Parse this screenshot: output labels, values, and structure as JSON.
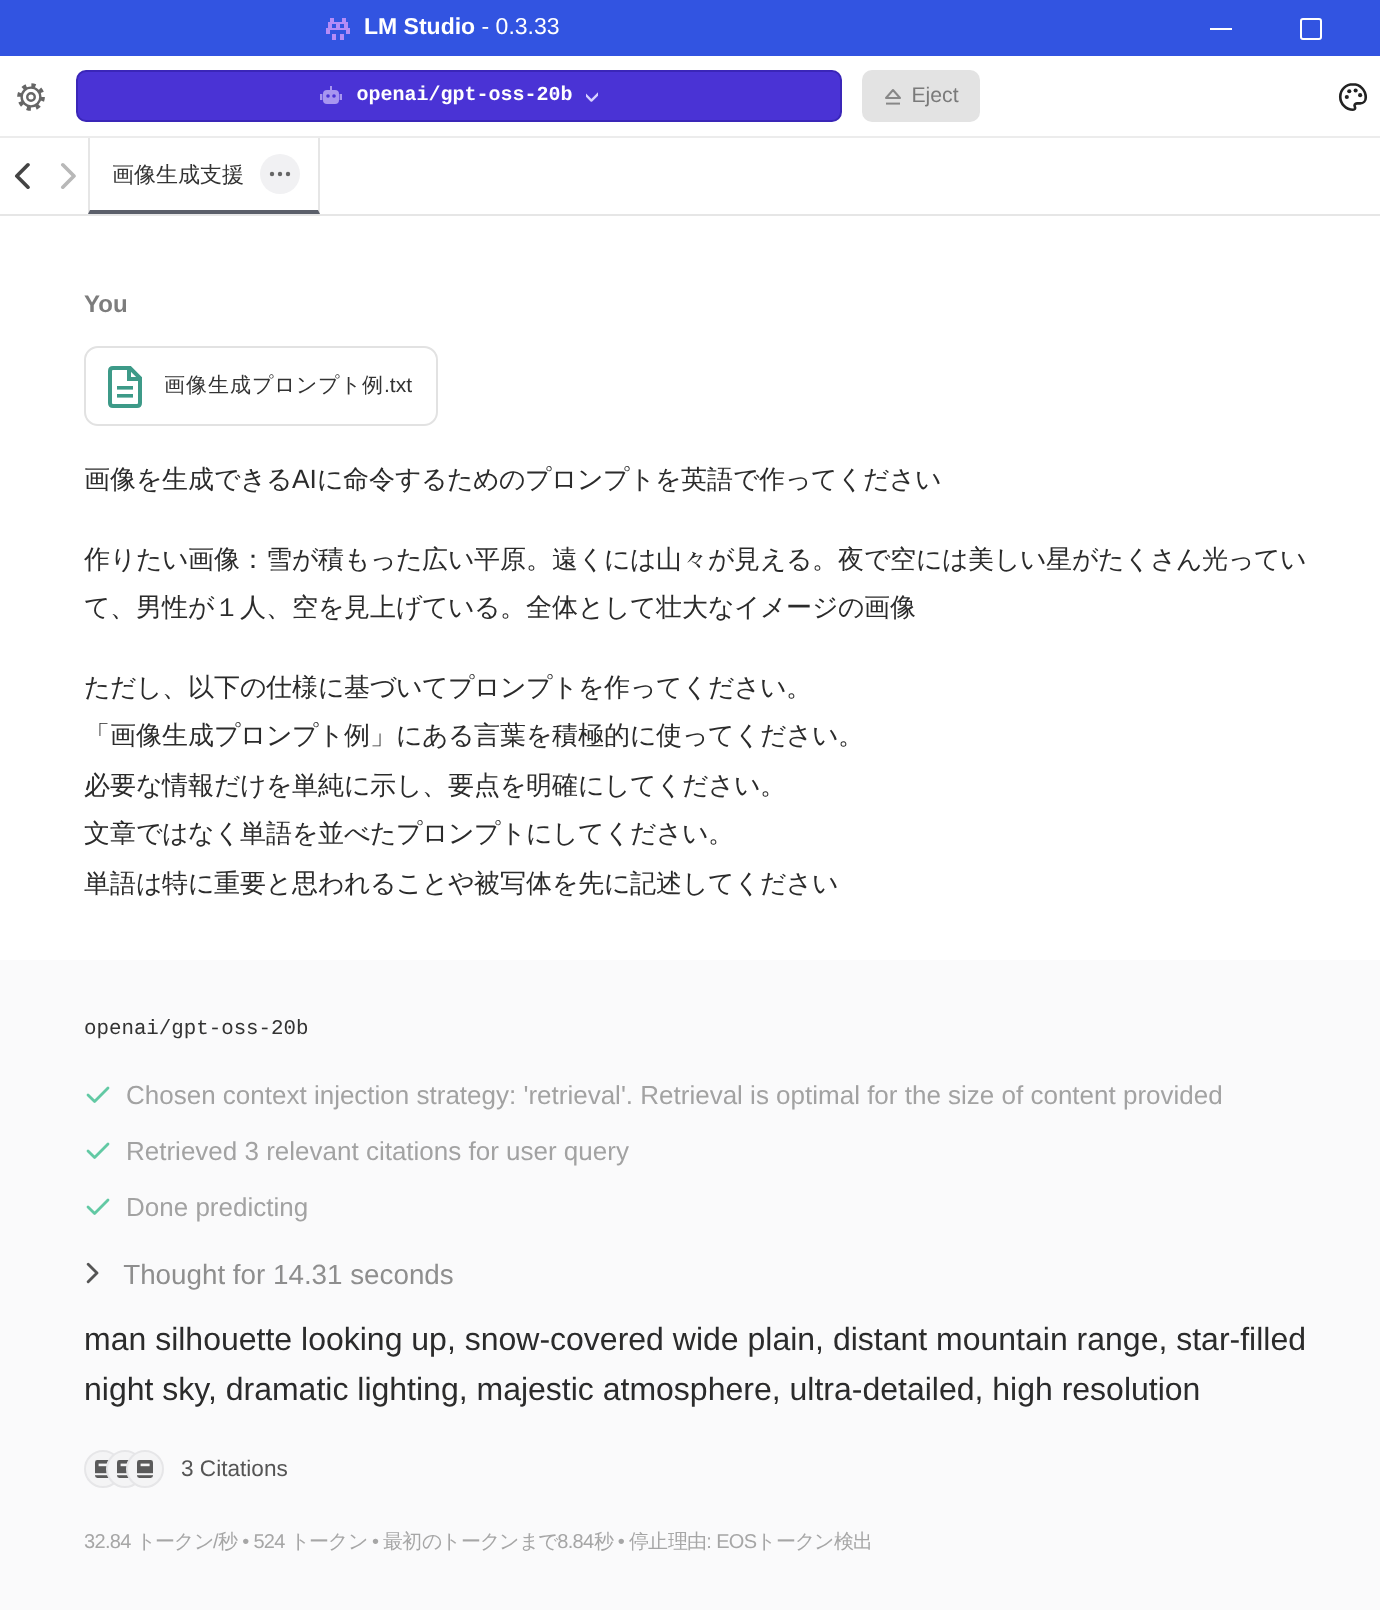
{
  "title_bar": {
    "title": "**LM Studio** - 0.3.33"
  },
  "toolbar": {
    "model": "openai/gpt-oss-20b",
    "eject": "Eject"
  },
  "tab_bar": {
    "nav": [
      {
        "kind": "back",
        "disabled": false
      },
      {
        "kind": "forward",
        "disabled": true
      }
    ],
    "tabs": [
      {
        "label": "画像生成支援",
        "selected": true
      }
    ]
  },
  "user_message": {
    "sender": "You",
    "attachments": [
      {
        "name": "画像生成プロンプト例.txt"
      }
    ],
    "paragraphs": [
      {
        "lines": [
          "画像を生成できるAIに命令するためのプロンプトを英語で作ってください"
        ]
      },
      {
        "lines": [
          "作りたい画像：雪が積もった広い平原。遠くには山々が見える。夜で空には美しい星がたくさん光っていて、男性が１人、空を見上げている。全体として壮大なイメージの画像"
        ]
      },
      {
        "lines": [
          "ただし、以下の仕様に基づいてプロンプトを作ってください。",
          "「画像生成プロンプト例」にある言葉を積極的に使ってください。",
          "必要な情報だけを単純に示し、要点を明確にしてください。",
          "文章ではなく単語を並べたプロンプトにしてください。",
          "単語は特に重要と思われることや被写体を先に記述してください"
        ]
      }
    ]
  },
  "assistant_message": {
    "model": "openai/gpt-oss-20b",
    "steps": [
      {
        "text": "Chosen context injection strategy: 'retrieval'. Retrieval is optimal for the size of content provided",
        "done": true
      },
      {
        "text": "Retrieved 3 relevant citations for user query",
        "done": true
      },
      {
        "text": "Done predicting",
        "done": true
      }
    ],
    "thought": {
      "label": "Thought for 14.31 seconds",
      "expanded": false
    },
    "response": "man silhouette looking up, snow-covered wide plain, distant mountain range, star-filled night sky, dramatic lighting, majestic atmosphere, ultra-detailed, high resolution",
    "citations": {
      "label": "3 Citations",
      "sources": [
        {
          "kind": "document"
        },
        {
          "kind": "document"
        },
        {
          "kind": "document"
        }
      ]
    },
    "stats": "32.84 トークン/秒 • 524 トークン • 最初のトークンまで8.84秒 • 停止理由: EOSトークン検出"
  }
}
